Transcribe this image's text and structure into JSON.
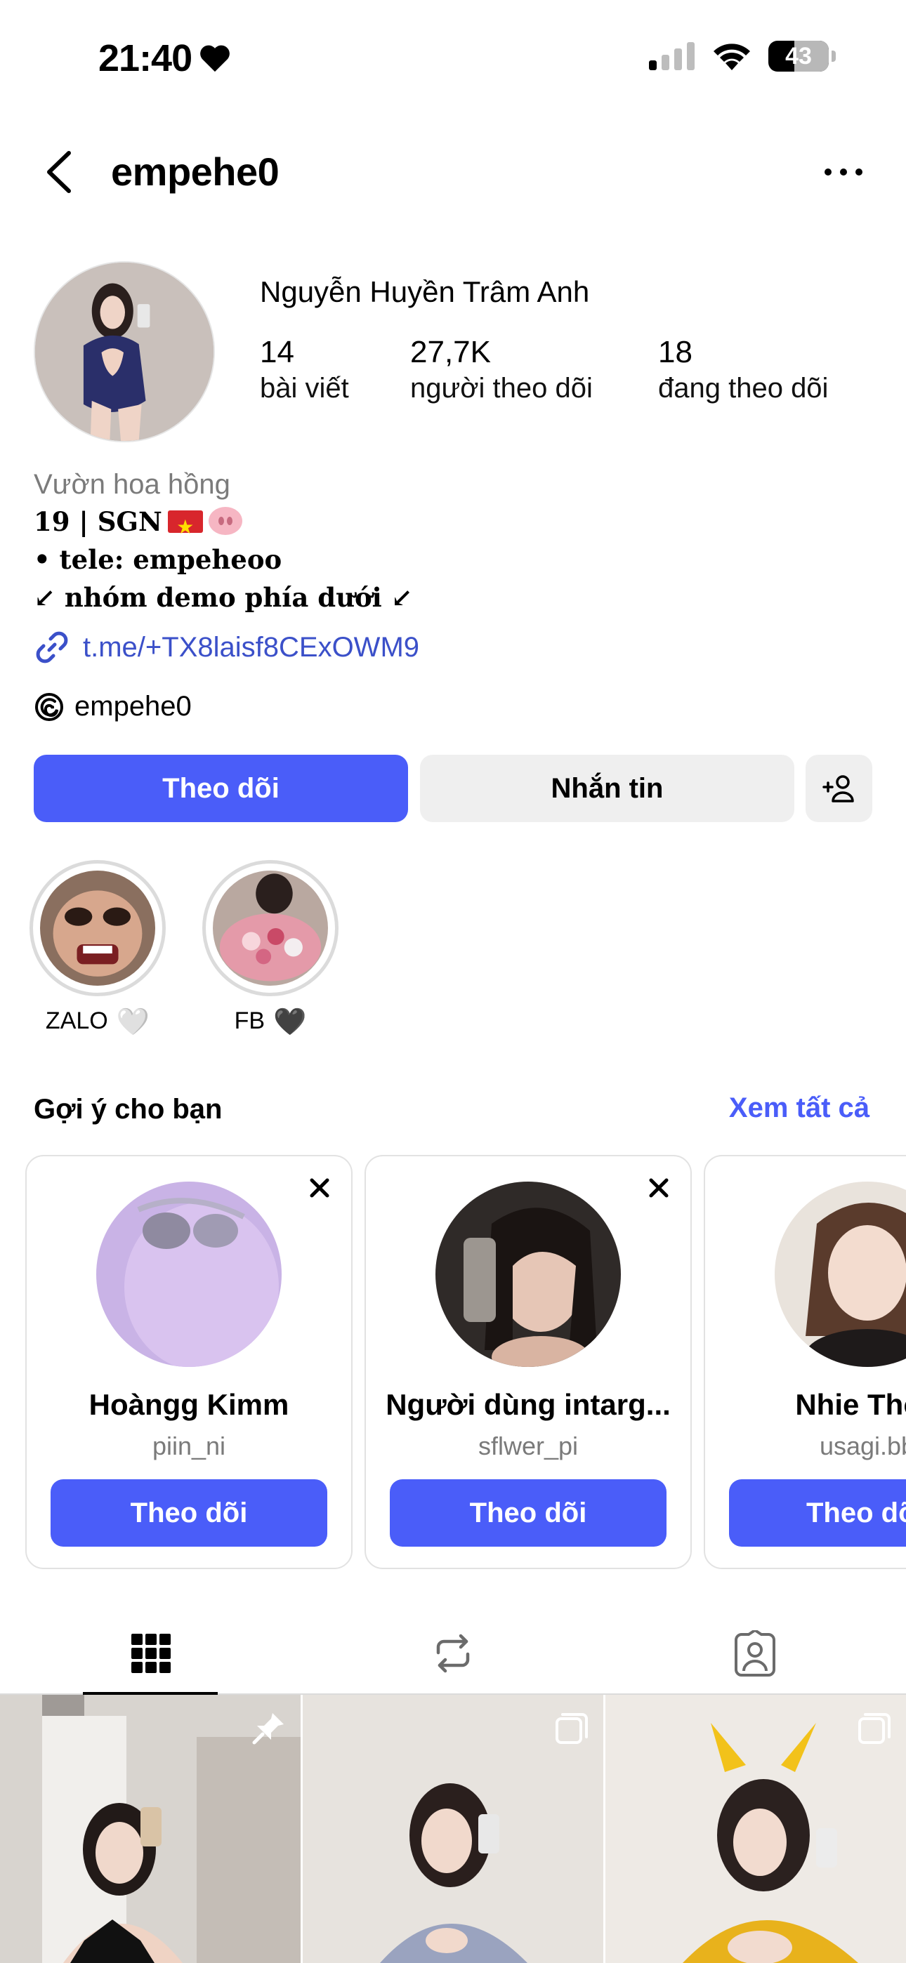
{
  "status_bar": {
    "time": "21:40",
    "battery": "43",
    "battery_level": 0.43
  },
  "header": {
    "username": "empehe0"
  },
  "profile": {
    "full_name": "Nguyễn Huyền Trâm Anh",
    "stats": [
      {
        "value": "14",
        "label": "bài viết"
      },
      {
        "value": "27,7K",
        "label": "người theo dõi"
      },
      {
        "value": "18",
        "label": "đang theo dõi"
      }
    ],
    "category": "Vườn hoa hồng",
    "bio_line_1": "19 | SGN",
    "bio_line_2": "• tele: empeheoo",
    "bio_line_3": "↙ nhóm demo phía dưới ↙",
    "link": "t.me/+TX8laisf8CExOWM9",
    "threads_handle": "empehe0"
  },
  "actions": {
    "follow": "Theo dõi",
    "message": "Nhắn tin"
  },
  "highlights": [
    {
      "label": "ZALO",
      "heart": "🤍"
    },
    {
      "label": "FB",
      "heart": "🖤"
    }
  ],
  "suggestions": {
    "title": "Gợi ý cho bạn",
    "see_all": "Xem tất cả",
    "cards": [
      {
        "name": "Hoàngg Kimm",
        "username": "piin_ni",
        "button": "Theo dõi"
      },
      {
        "name": "Người dùng intarg...",
        "username": "sflwer_pi",
        "button": "Theo dõi"
      },
      {
        "name": "Nhie Thỏ (",
        "username": "usagi.bb",
        "button": "Theo dõ"
      }
    ]
  },
  "tabs": [
    "grid-icon",
    "repost-icon",
    "tagged-icon"
  ],
  "colors": {
    "accent": "#4a5df9",
    "link": "#3b50c9",
    "secondary_button": "#efefef"
  }
}
